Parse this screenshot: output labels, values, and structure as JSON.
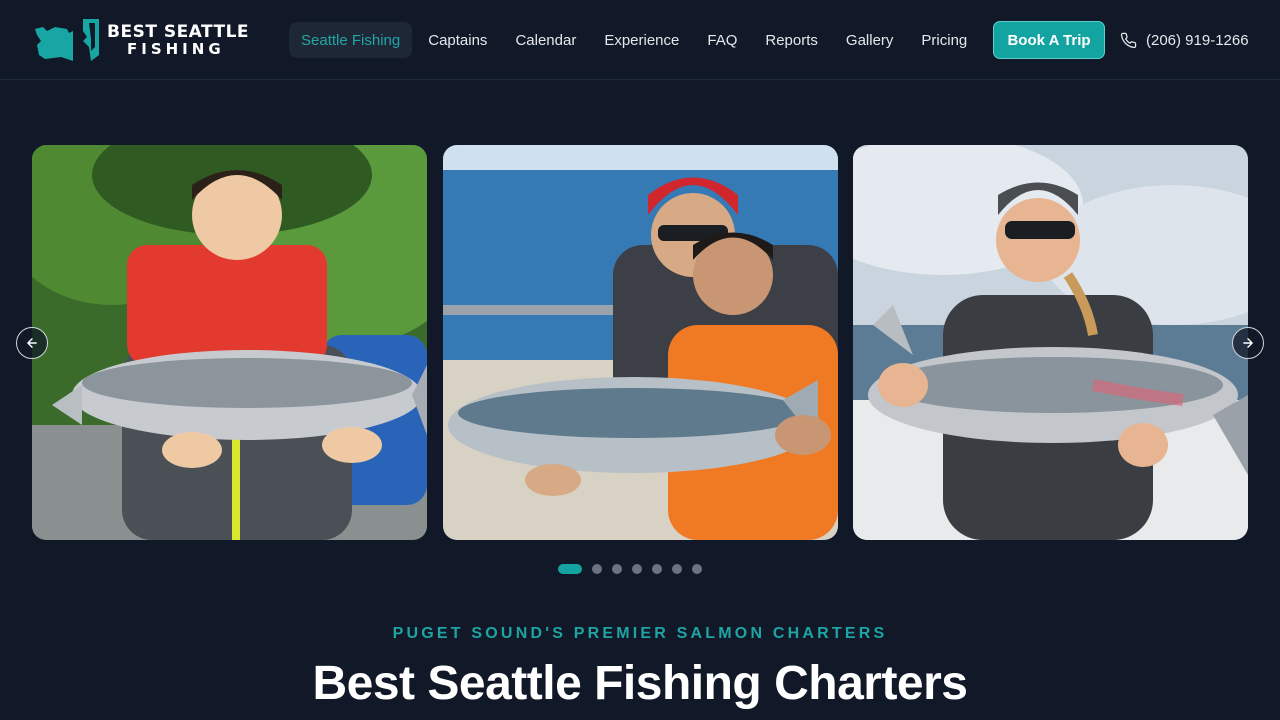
{
  "brand": {
    "line1": "BEST SEATTLE",
    "line2": "FISHING"
  },
  "nav": {
    "items": [
      {
        "label": "Seattle Fishing",
        "active": true
      },
      {
        "label": "Captains"
      },
      {
        "label": "Calendar"
      },
      {
        "label": "Experience"
      },
      {
        "label": "FAQ"
      },
      {
        "label": "Reports"
      },
      {
        "label": "Gallery"
      },
      {
        "label": "Pricing"
      }
    ],
    "cta_label": "Book A Trip",
    "phone": "(206) 919-1266"
  },
  "carousel": {
    "slides": [
      {
        "icon": "photo-boy-with-salmon"
      },
      {
        "icon": "photo-man-and-boy-with-salmon"
      },
      {
        "icon": "photo-woman-with-salmon"
      }
    ],
    "prev_icon": "arrow-left-icon",
    "next_icon": "arrow-right-icon",
    "dot_count": 7,
    "active_index": 0
  },
  "hero": {
    "eyebrow": "PUGET SOUND'S PREMIER SALMON CHARTERS",
    "title": "Best Seattle Fishing Charters"
  },
  "colors": {
    "background": "#111827",
    "accent": "#14a3a1",
    "text": "#e5e7eb"
  }
}
